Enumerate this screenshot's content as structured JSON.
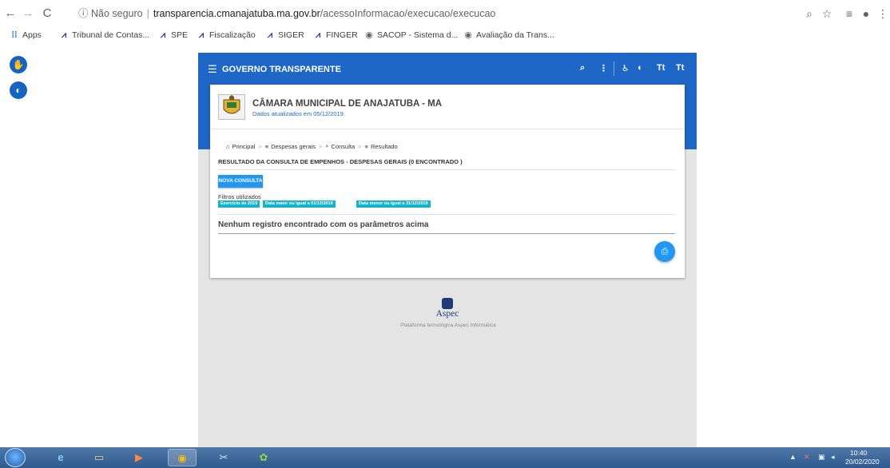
{
  "browser": {
    "info_icon": "info-icon",
    "security_label": "Não seguro",
    "url_host": "transparencia.cmanajatuba.ma.gov.br",
    "url_path": "/acessoInformacao/execucao/execucao",
    "bookmarks": [
      {
        "label": "Apps",
        "icon": "apps-grid-icon"
      },
      {
        "label": "Tribunal de Contas...",
        "icon": "tce-logo-icon"
      },
      {
        "label": "SPE",
        "icon": "tce-logo-icon"
      },
      {
        "label": "Fiscalização",
        "icon": "tce-logo-icon"
      },
      {
        "label": "SIGER",
        "icon": "tce-logo-icon"
      },
      {
        "label": "FINGER",
        "icon": "tce-logo-icon"
      },
      {
        "label": "SACOP - Sistema d...",
        "icon": "globe-icon"
      },
      {
        "label": "Avaliação da Trans...",
        "icon": "globe-icon"
      }
    ]
  },
  "site": {
    "title": "GOVERNO TRANSPARENTE",
    "font_decrease": "Tt",
    "font_increase": "Tt",
    "org_name": "CÂMARA MUNICIPAL DE ANAJATUBA - MA",
    "updated": "Dados atualizados em 05/12/2019.",
    "breadcrumb": [
      {
        "label": "Principal",
        "icon": "home-icon"
      },
      {
        "label": "Despesas gerais",
        "icon": "list-icon"
      },
      {
        "label": "Consulta",
        "icon": "search-icon"
      },
      {
        "label": "Resultado",
        "icon": "list-icon"
      }
    ],
    "result_title": "RESULTADO DA CONSULTA DE EMPENHOS - DESPESAS GERAIS (0 ENCONTRADO )",
    "new_query_label": "NOVA CONSULTA",
    "filters_label": "Filtros utilizados",
    "filters": [
      "Exercício de 2019",
      "Data maior ou igual a 01/12/2019",
      "Data menor ou igual a 31/12/2019"
    ],
    "no_records": "Nenhum registro encontrado com os parâmetros acima",
    "footer_brand": "Aspec",
    "footer_tagline": "Plataforma tecnológica Aspec Informática"
  },
  "taskbar": {
    "time": "10:40",
    "date": "20/02/2020"
  },
  "colors": {
    "header_blue": "#1e67c6",
    "button_blue": "#2196f3",
    "chip_teal": "#14b3c8"
  }
}
